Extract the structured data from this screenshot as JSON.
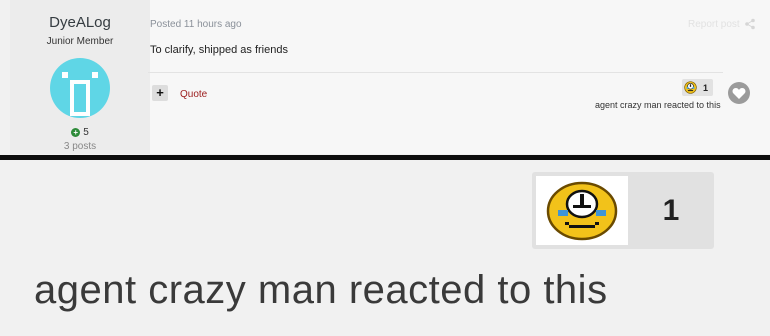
{
  "author": {
    "name": "DyeALog",
    "rank": "Junior Member",
    "reputation": "5",
    "posts": "3 posts",
    "avatar_color": "#5fd6e6"
  },
  "post": {
    "posted": "Posted 11 hours ago",
    "report_label": "Report post",
    "content": "To clarify, shipped as friends",
    "quote_label": "Quote",
    "plus_label": "+"
  },
  "reaction": {
    "count": "1",
    "reacted_text": "agent crazy man reacted to this",
    "icon": "crying-face-icon"
  },
  "zoom": {
    "count": "1",
    "reacted_text": "agent crazy man reacted to this"
  },
  "colors": {
    "quote": "#9b1b1b",
    "reputation": "#2e8b3a",
    "separator": "#0d0d0d"
  }
}
